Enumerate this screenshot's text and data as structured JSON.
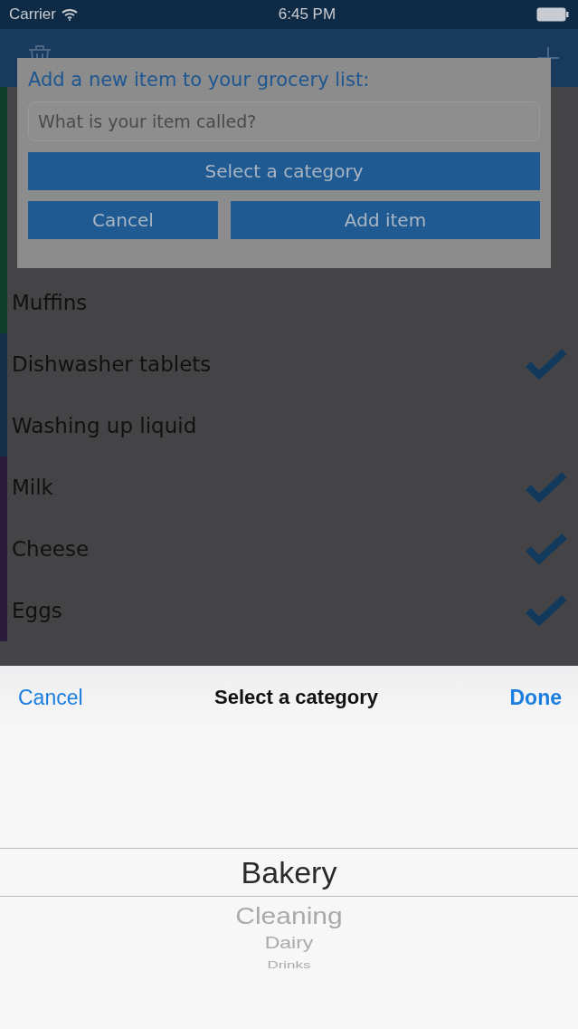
{
  "status_bar": {
    "carrier": "Carrier",
    "time": "6:45 PM"
  },
  "list": [
    {
      "color": "#0f3d2c"
    },
    {
      "color": "#0f3d2c"
    },
    {
      "color": "#0f3d2c"
    },
    {
      "name": "Muffins",
      "color": "#0f3d2c",
      "checked": false
    },
    {
      "name": "Dishwasher tablets",
      "color": "#16304a",
      "checked": true
    },
    {
      "name": "Washing up liquid",
      "color": "#16304a",
      "checked": false
    },
    {
      "name": "Milk",
      "color": "#2a1c3a",
      "checked": true
    },
    {
      "name": "Cheese",
      "color": "#2a1c3a",
      "checked": true
    },
    {
      "name": "Eggs",
      "color": "#2a1c3a",
      "checked": true
    }
  ],
  "dialog": {
    "title": "Add a new item to your grocery list:",
    "placeholder": "What is your item called?",
    "category_button": "Select a category",
    "cancel": "Cancel",
    "add": "Add item"
  },
  "picker": {
    "cancel": "Cancel",
    "title": "Select a category",
    "done": "Done",
    "options": [
      {
        "label": "Bakery",
        "selected": true
      },
      {
        "label": "Cleaning",
        "selected": false
      },
      {
        "label": "Dairy",
        "selected": false
      },
      {
        "label": "Drinks",
        "selected": false
      }
    ]
  }
}
